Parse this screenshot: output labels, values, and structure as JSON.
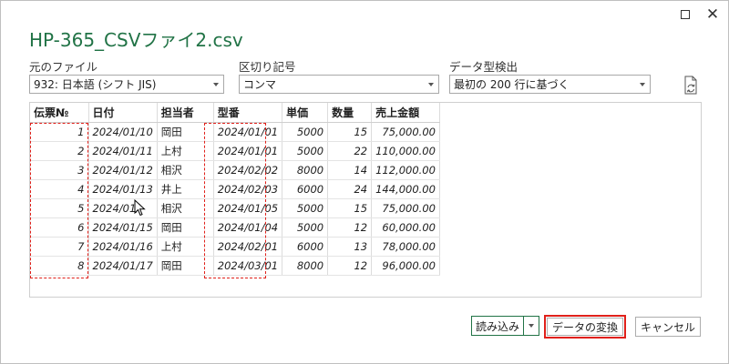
{
  "window": {
    "title": "HP-365_CSVファイ2.csv",
    "maximize_glyph": "",
    "close_glyph": "✕"
  },
  "fields": {
    "origin": {
      "label": "元のファイル",
      "value": "932: 日本語 (シフト JIS)"
    },
    "delimiter": {
      "label": "区切り記号",
      "value": "コンマ"
    },
    "detection": {
      "label": "データ型検出",
      "value": "最初の 200 行に基づく"
    }
  },
  "table": {
    "columns": [
      "伝票№",
      "日付",
      "担当者",
      "型番",
      "単価",
      "数量",
      "売上金額"
    ],
    "rows": [
      [
        "1",
        "2024/01/10",
        "岡田",
        "2024/01/01",
        "5000",
        "15",
        "75,000.00"
      ],
      [
        "2",
        "2024/01/11",
        "上村",
        "2024/01/01",
        "5000",
        "22",
        "110,000.00"
      ],
      [
        "3",
        "2024/01/12",
        "相沢",
        "2024/02/02",
        "8000",
        "14",
        "112,000.00"
      ],
      [
        "4",
        "2024/01/13",
        "井上",
        "2024/02/03",
        "6000",
        "24",
        "144,000.00"
      ],
      [
        "5",
        "2024/01/",
        "相沢",
        "2024/01/05",
        "5000",
        "15",
        "75,000.00"
      ],
      [
        "6",
        "2024/01/15",
        "岡田",
        "2024/01/04",
        "5000",
        "12",
        "60,000.00"
      ],
      [
        "7",
        "2024/01/16",
        "上村",
        "2024/02/01",
        "6000",
        "13",
        "78,000.00"
      ],
      [
        "8",
        "2024/01/17",
        "岡田",
        "2024/03/01",
        "8000",
        "12",
        "96,000.00"
      ]
    ]
  },
  "buttons": {
    "load": "読み込み",
    "transform": "データの変換",
    "cancel": "キャンセル"
  },
  "colors": {
    "title_green": "#217346",
    "highlight_red": "#e0201a"
  },
  "icons": {
    "refresh": "refresh-file-icon",
    "cursor": "mouse-pointer-icon"
  }
}
